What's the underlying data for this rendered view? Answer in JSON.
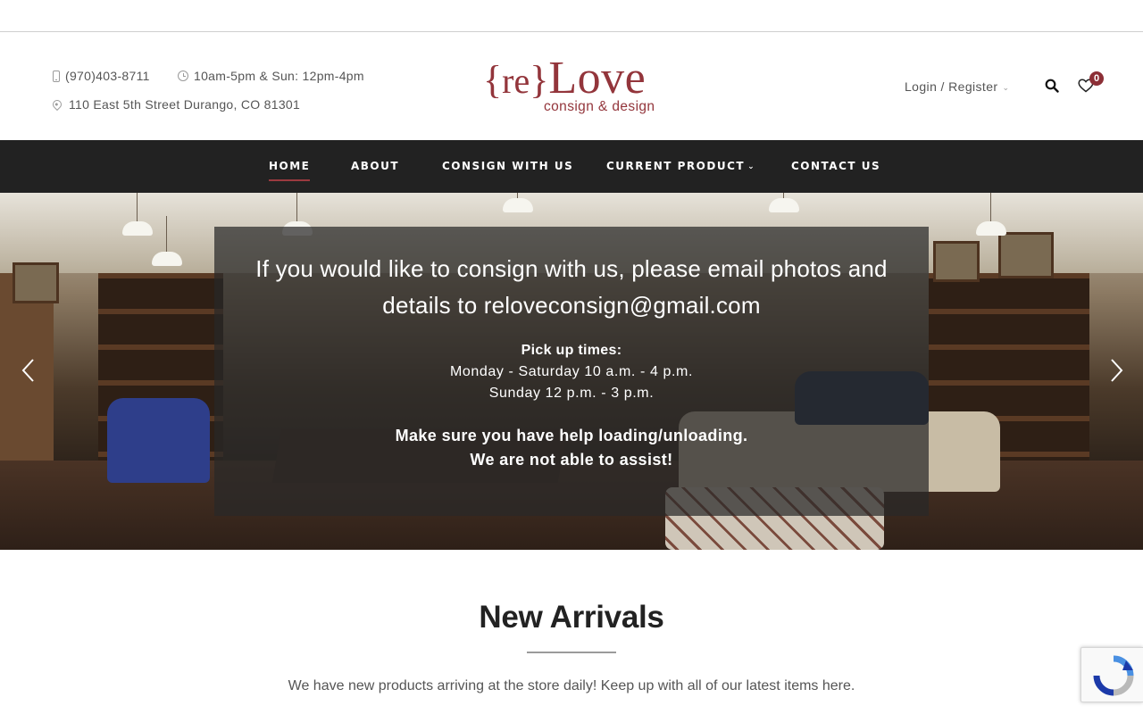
{
  "header": {
    "phone": "(970)403-8711",
    "hours": "10am-5pm & Sun: 12pm-4pm",
    "address": "110 East 5th Street Durango, CO 81301",
    "logo": {
      "brace_left": "{",
      "re": "re",
      "brace_right": "}",
      "love": "Love",
      "tagline": "consign & design"
    },
    "login_label": "Login / Register",
    "wishlist_count": "0"
  },
  "nav": {
    "items": [
      {
        "label": "HOME"
      },
      {
        "label": "ABOUT"
      },
      {
        "label": "CONSIGN WITH US"
      },
      {
        "label": "CURRENT PRODUCT"
      },
      {
        "label": "CONTACT US"
      }
    ],
    "chevron": "⌄"
  },
  "hero": {
    "line1": "If you would like to consign with us, please email photos and",
    "line2": "details to reloveconsign@gmail.com",
    "pickup_label": "Pick up times:",
    "pickup_weekday": "Monday - Saturday 10 a.m. - 4 p.m.",
    "pickup_sunday": "Sunday 12 p.m. - 3 p.m.",
    "notice_line1": "Make sure you have help loading/unloading.",
    "notice_line2": "We are not able to assist!"
  },
  "arrivals": {
    "title": "New Arrivals",
    "subtitle": "We have new products arriving at the store daily!  Keep up with all of our latest items here."
  },
  "colors": {
    "brand": "#93353b",
    "nav_bg": "#222222",
    "badge": "#8c2f36"
  }
}
